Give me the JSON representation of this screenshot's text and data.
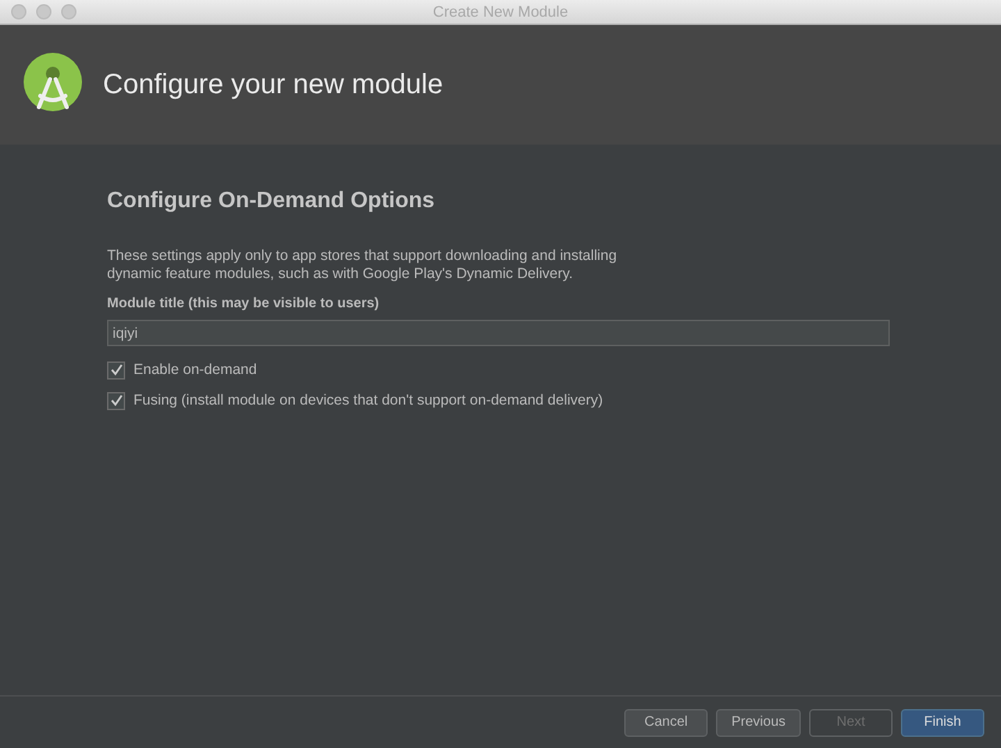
{
  "window": {
    "title": "Create New Module"
  },
  "header": {
    "title": "Configure your new module"
  },
  "section": {
    "title": "Configure On-Demand Options",
    "description": "These settings apply only to app stores that support downloading and installing\ndynamic feature modules, such as with Google Play's Dynamic Delivery.",
    "field": {
      "label": "Module title (this may be visible to users)",
      "value": "iqiyi"
    },
    "options": [
      {
        "label": "Enable on-demand",
        "checked": true
      },
      {
        "label": "Fusing (install module on devices that don't support on-demand delivery)",
        "checked": true
      }
    ]
  },
  "buttons": [
    {
      "label": "Cancel",
      "kind": "normal",
      "disabled": false
    },
    {
      "label": "Previous",
      "kind": "normal",
      "disabled": false
    },
    {
      "label": "Next",
      "kind": "normal",
      "disabled": true
    },
    {
      "label": "Finish",
      "kind": "primary",
      "disabled": false
    }
  ]
}
